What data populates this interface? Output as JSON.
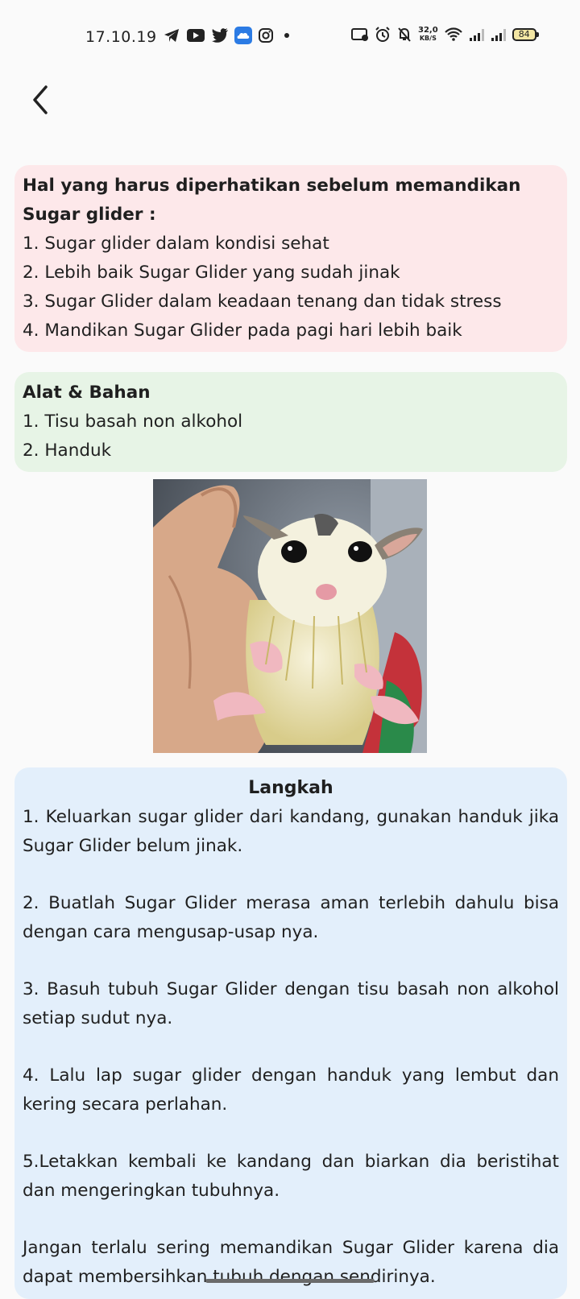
{
  "status_bar": {
    "time": "17.10.19",
    "left_icons": [
      "telegram-icon",
      "youtube-icon",
      "twitter-icon",
      "cloud-app-icon",
      "instagram-icon",
      "notification-dot-icon"
    ],
    "right_icons": [
      "cast-icon",
      "alarm-icon",
      "mute-icon",
      "data-speed",
      "wifi-icon",
      "signal-icon",
      "signal-icon",
      "battery-icon"
    ],
    "speed_value": "32,0",
    "speed_unit": "KB/S",
    "battery": "84"
  },
  "header": {
    "back_icon": "chevron-left-icon"
  },
  "prep_card": {
    "title_line1": "Hal yang harus diperhatikan sebelum memandikan",
    "title_line2": "Sugar glider :",
    "items": [
      "1. Sugar glider dalam kondisi sehat",
      "2. Lebih baik Sugar Glider yang sudah jinak",
      "3. Sugar Glider dalam keadaan tenang dan tidak stress",
      "4. Mandikan Sugar Glider pada pagi hari lebih baik"
    ],
    "color": "#fde8ea"
  },
  "tools_card": {
    "title": "Alat & Bahan",
    "items": [
      "1. Tisu basah non alkohol",
      "2. Handuk"
    ],
    "color": "#e7f4e6"
  },
  "photo": {
    "subject": "wet sugar glider held in hand"
  },
  "steps_card": {
    "title": "Langkah",
    "steps": [
      "1. Keluarkan sugar glider dari kandang, gunakan handuk jika Sugar Glider belum jinak.",
      "2. Buatlah Sugar Glider merasa aman terlebih dahulu bisa dengan cara mengusap-usap nya.",
      "3. Basuh tubuh Sugar Glider dengan tisu basah non alkohol setiap sudut nya.",
      "4. Lalu lap sugar glider dengan handuk yang lembut dan kering secara perlahan.",
      "5.Letakkan kembali ke kandang dan biarkan dia beristihat dan mengeringkan tubuhnya."
    ],
    "note": "Jangan terlalu sering memandikan Sugar Glider karena dia dapat membersihkan tubuh dengan sendirinya.",
    "color": "#e3effb"
  }
}
